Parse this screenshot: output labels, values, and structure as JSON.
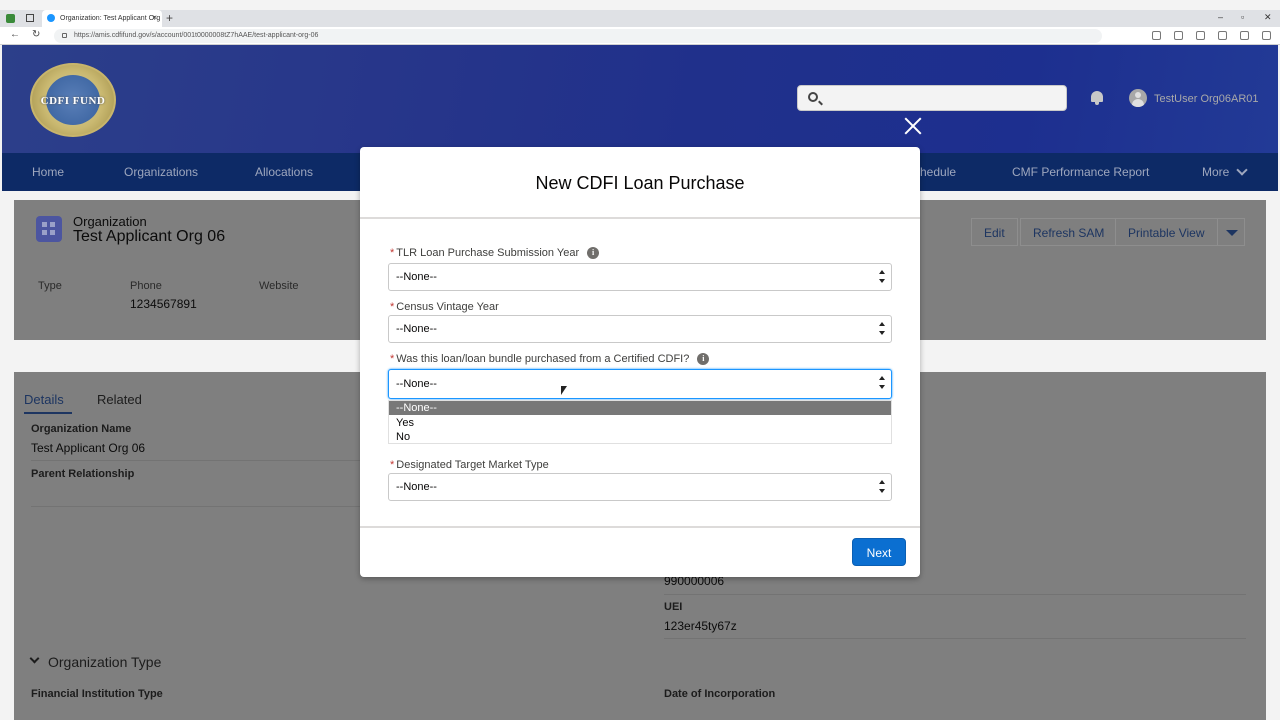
{
  "browser": {
    "tab_title": "Organization: Test Applicant Org",
    "url": "https://amis.cdfifund.gov/s/account/001t0000008tZ7hAAE/test-applicant-org-06"
  },
  "header": {
    "logo_text": "CDFI FUND",
    "username": "TestUser Org06AR01"
  },
  "nav": {
    "items": [
      "Home",
      "Organizations",
      "Allocations",
      "...hedule",
      "CMF Performance Report",
      "More"
    ]
  },
  "record": {
    "object_label": "Organization",
    "name": "Test Applicant Org 06",
    "buttons": [
      "Edit",
      "Refresh SAM",
      "Printable View"
    ],
    "highlights": {
      "type_label": "Type",
      "phone_label": "Phone",
      "phone_value": "1234567891",
      "website_label": "Website"
    },
    "tabs": [
      "Details",
      "Related"
    ],
    "details": {
      "org_name_label": "Organization Name",
      "org_name_value": "Test Applicant Org 06",
      "parent_label": "Parent Relationship",
      "partial_value": "990000006",
      "uei_label": "UEI",
      "uei_value": "123er45ty67z",
      "section_title": "Organization Type",
      "fin_type_label": "Financial Institution Type",
      "incorp_label": "Date of Incorporation"
    }
  },
  "modal": {
    "title": "New CDFI Loan Purchase",
    "fields": [
      {
        "label": "TLR Loan Purchase Submission Year",
        "value": "--None--",
        "has_info": true
      },
      {
        "label": "Census Vintage Year",
        "value": "--None--",
        "has_info": false
      },
      {
        "label": "Was this loan/loan bundle purchased from a Certified CDFI?",
        "value": "--None--",
        "has_info": true
      },
      {
        "label": "Designated Target Market Type",
        "value": "--None--",
        "has_info": false
      }
    ],
    "required_mark": "*",
    "info_glyph": "i",
    "dropdown_options": [
      "--None--",
      "Yes",
      "No"
    ],
    "next_label": "Next"
  }
}
